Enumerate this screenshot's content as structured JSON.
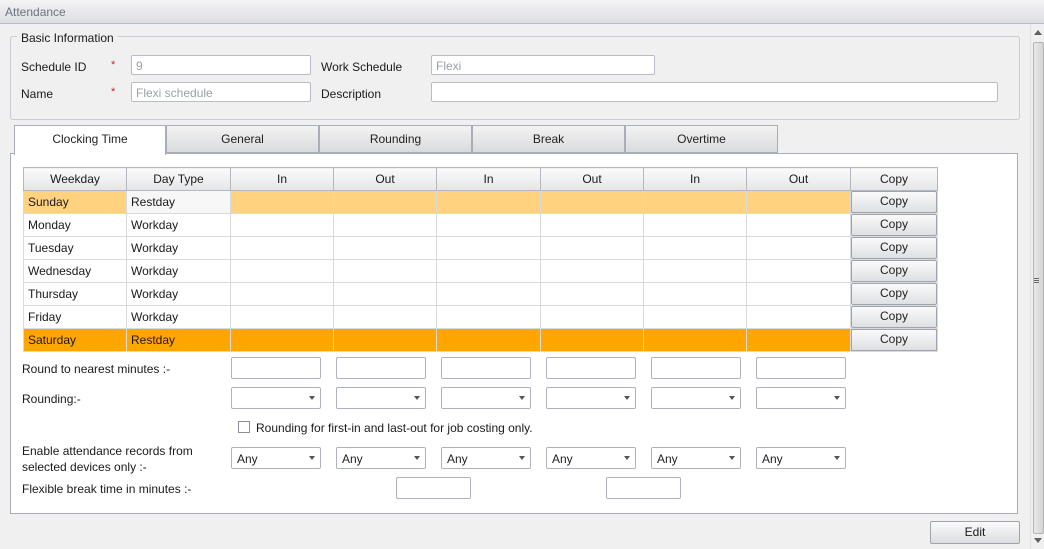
{
  "window": {
    "title": "Attendance"
  },
  "basic": {
    "legend": "Basic Information",
    "schedule_id_label": "Schedule ID",
    "schedule_id_value": "9",
    "name_label": "Name",
    "name_value": "Flexi schedule",
    "work_schedule_label": "Work Schedule",
    "work_schedule_value": "Flexi",
    "description_label": "Description",
    "description_value": "",
    "required_mark": "*"
  },
  "tabs": [
    {
      "label": "Clocking Time",
      "active": true
    },
    {
      "label": "General"
    },
    {
      "label": "Rounding"
    },
    {
      "label": "Break"
    },
    {
      "label": "Overtime"
    }
  ],
  "grid": {
    "headers": [
      "Weekday",
      "Day Type",
      "In",
      "Out",
      "In",
      "Out",
      "In",
      "Out",
      "Copy"
    ],
    "copy_label": "Copy",
    "rows": [
      {
        "weekday": "Sunday",
        "day_type": "Restday"
      },
      {
        "weekday": "Monday",
        "day_type": "Workday"
      },
      {
        "weekday": "Tuesday",
        "day_type": "Workday"
      },
      {
        "weekday": "Wednesday",
        "day_type": "Workday"
      },
      {
        "weekday": "Thursday",
        "day_type": "Workday"
      },
      {
        "weekday": "Friday",
        "day_type": "Workday"
      },
      {
        "weekday": "Saturday",
        "day_type": "Restday"
      }
    ],
    "colors": {
      "sunday_row": "#ffd280",
      "saturday_row": "#ffa500"
    }
  },
  "options": {
    "round_nearest_label": "Round to nearest minutes :-",
    "rounding_label": "Rounding:-",
    "rounding_checkbox_label": "Rounding for first-in and last-out for job costing only.",
    "enable_records_label_1": "Enable attendance records from",
    "enable_records_label_2": "selected devices only :-",
    "device_values": [
      "Any",
      "Any",
      "Any",
      "Any",
      "Any",
      "Any"
    ],
    "flexible_break_label": "Flexible break time in minutes :-"
  },
  "footer": {
    "edit_label": "Edit"
  }
}
